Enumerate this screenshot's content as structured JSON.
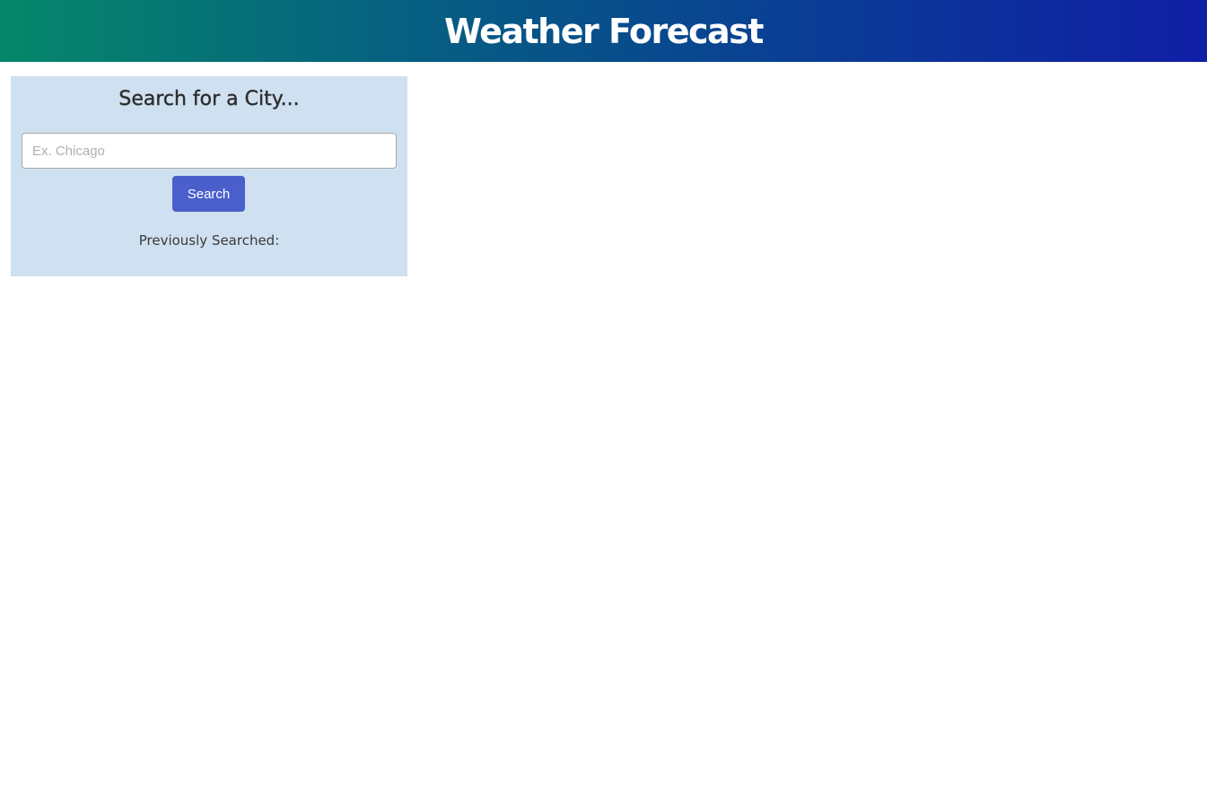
{
  "header": {
    "title": "Weather Forecast"
  },
  "search": {
    "heading": "Search for a City...",
    "placeholder": "Ex. Chicago",
    "value": "",
    "button_label": "Search",
    "previous_label": "Previously Searched:"
  },
  "colors": {
    "header_gradient_start": "#05876a",
    "header_gradient_end": "#101ea6",
    "panel_background": "#cfe0f0",
    "button_background": "#4a5fcb"
  }
}
